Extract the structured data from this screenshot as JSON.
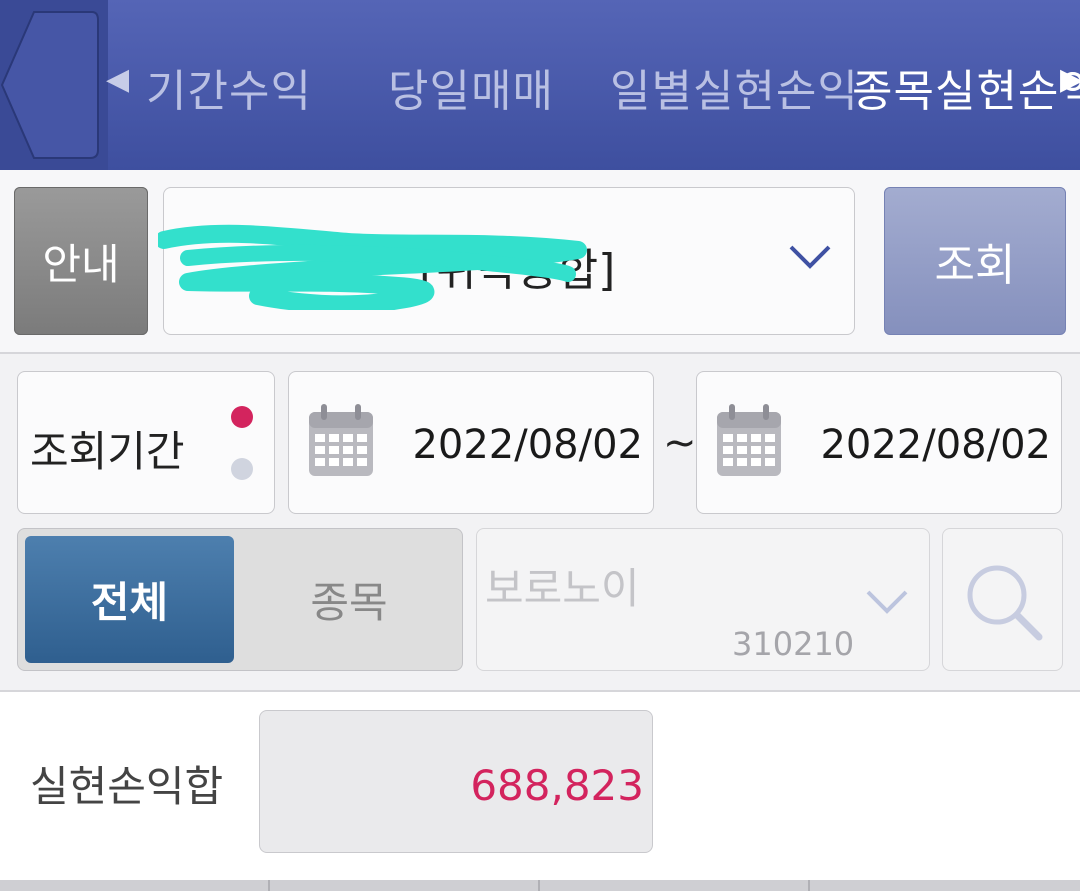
{
  "header": {
    "tabs": [
      {
        "label": "기간수익",
        "active": false
      },
      {
        "label": "당일매매",
        "active": false
      },
      {
        "label": "일별실현손익",
        "active": false
      },
      {
        "label": "종목실현손익",
        "active": true
      }
    ],
    "arrow_left": "◀",
    "arrow_right": "▶"
  },
  "account": {
    "info_label": "안내",
    "selected_text": "[위탁종합]",
    "query_label": "조회"
  },
  "period": {
    "label": "조회기간",
    "start_date": "2022/08/02",
    "separator": "~",
    "end_date": "2022/08/02"
  },
  "filter": {
    "all_label": "전체",
    "stock_label": "종목",
    "stock_name": "보로노이",
    "stock_code": "310210"
  },
  "summary": {
    "label": "실현손익합",
    "value": "688,823"
  },
  "colors": {
    "header_bg": "#4555a8",
    "accent_pink": "#d3245e",
    "segment_active": "#3d6e9f",
    "query_button": "#8f9ac5"
  }
}
